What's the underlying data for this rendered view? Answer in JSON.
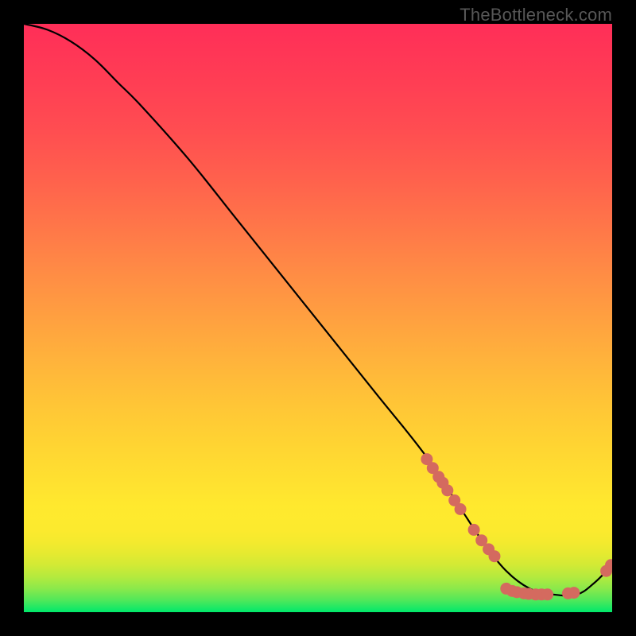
{
  "watermark": "TheBottleneck.com",
  "chart_data": {
    "type": "line",
    "title": "",
    "xlabel": "",
    "ylabel": "",
    "xlim": [
      0,
      100
    ],
    "ylim": [
      0,
      100
    ],
    "curve": {
      "x": [
        0,
        4,
        8,
        12,
        16,
        20,
        28,
        36,
        44,
        52,
        60,
        68,
        74,
        78,
        82,
        86,
        90,
        94,
        97,
        100
      ],
      "y": [
        100,
        99,
        97,
        94,
        90,
        86,
        77,
        67,
        57,
        47,
        37,
        27,
        18,
        12,
        7,
        4,
        3,
        3,
        5,
        8
      ]
    },
    "markers": [
      {
        "x": 68.5,
        "y": 26
      },
      {
        "x": 69.5,
        "y": 24.5
      },
      {
        "x": 70.5,
        "y": 23
      },
      {
        "x": 71.2,
        "y": 22
      },
      {
        "x": 72.0,
        "y": 20.7
      },
      {
        "x": 73.2,
        "y": 19
      },
      {
        "x": 74.2,
        "y": 17.5
      },
      {
        "x": 76.5,
        "y": 14
      },
      {
        "x": 77.8,
        "y": 12.2
      },
      {
        "x": 79.0,
        "y": 10.7
      },
      {
        "x": 80.0,
        "y": 9.5
      },
      {
        "x": 82.0,
        "y": 4.0
      },
      {
        "x": 83.0,
        "y": 3.6
      },
      {
        "x": 83.8,
        "y": 3.4
      },
      {
        "x": 85.0,
        "y": 3.2
      },
      {
        "x": 85.8,
        "y": 3.1
      },
      {
        "x": 87.0,
        "y": 3.0
      },
      {
        "x": 88.0,
        "y": 3.0
      },
      {
        "x": 89.0,
        "y": 3.0
      },
      {
        "x": 92.5,
        "y": 3.2
      },
      {
        "x": 93.5,
        "y": 3.3
      },
      {
        "x": 99.0,
        "y": 7.0
      },
      {
        "x": 99.8,
        "y": 8.0
      }
    ],
    "marker_radius_px": 7.5,
    "marker_color": "#d46a5f",
    "line_color": "#000000"
  }
}
